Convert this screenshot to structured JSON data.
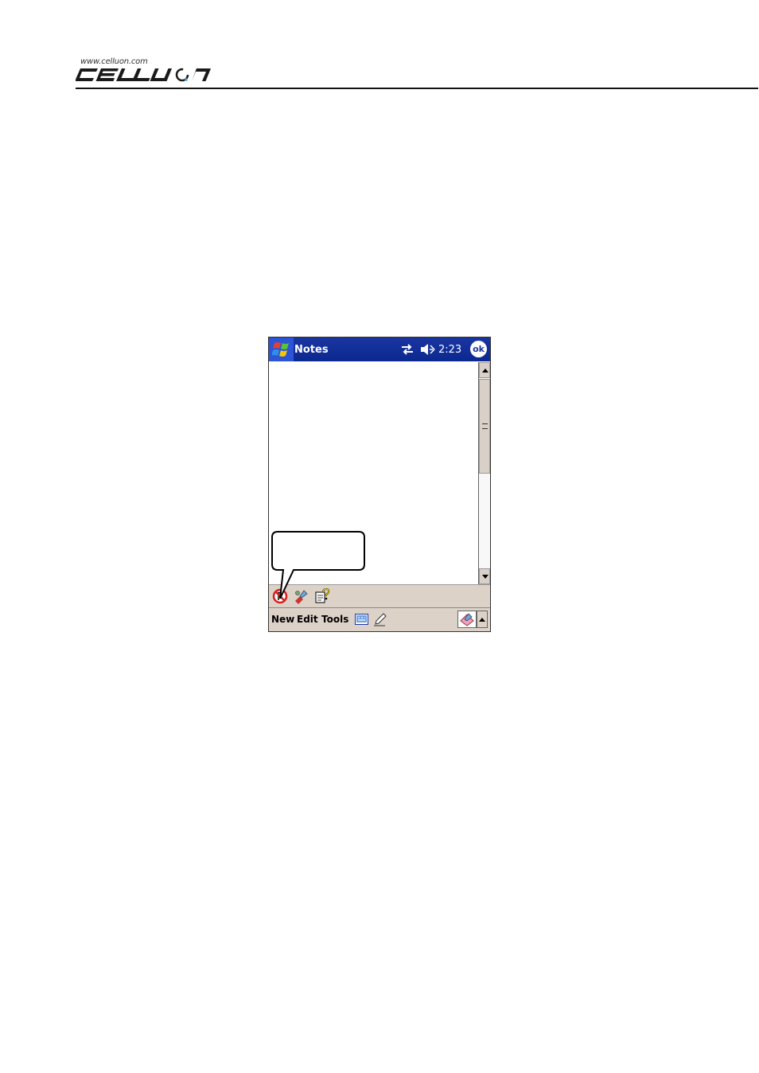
{
  "header": {
    "logo_url": "www.celluon.com",
    "logo_text": "CELLUON"
  },
  "device": {
    "nav_bar": {
      "app_title": "Notes",
      "time": "2:23",
      "ok_label": "ok",
      "icons": [
        "windows-start-icon",
        "sync-arrows-icon",
        "speaker-muted-icon"
      ]
    },
    "toolbar": {
      "icons": [
        "no-recording-icon",
        "pen-tool-icon",
        "help-document-icon"
      ]
    },
    "menu_bar": {
      "items": [
        "New",
        "Edit",
        "Tools"
      ],
      "icons": [
        "keyboard-icon",
        "pencil-icon",
        "input-panel-icon"
      ]
    },
    "callout": {
      "text": ""
    }
  },
  "colors": {
    "nav_bar": "#0b2890",
    "start_button": "#2b54d6",
    "toolbar": "#ddd2c8",
    "scrollbar_thumb": "#d9d0c7",
    "alert_red": "#d81e1e",
    "help_yellow": "#f2e100"
  }
}
